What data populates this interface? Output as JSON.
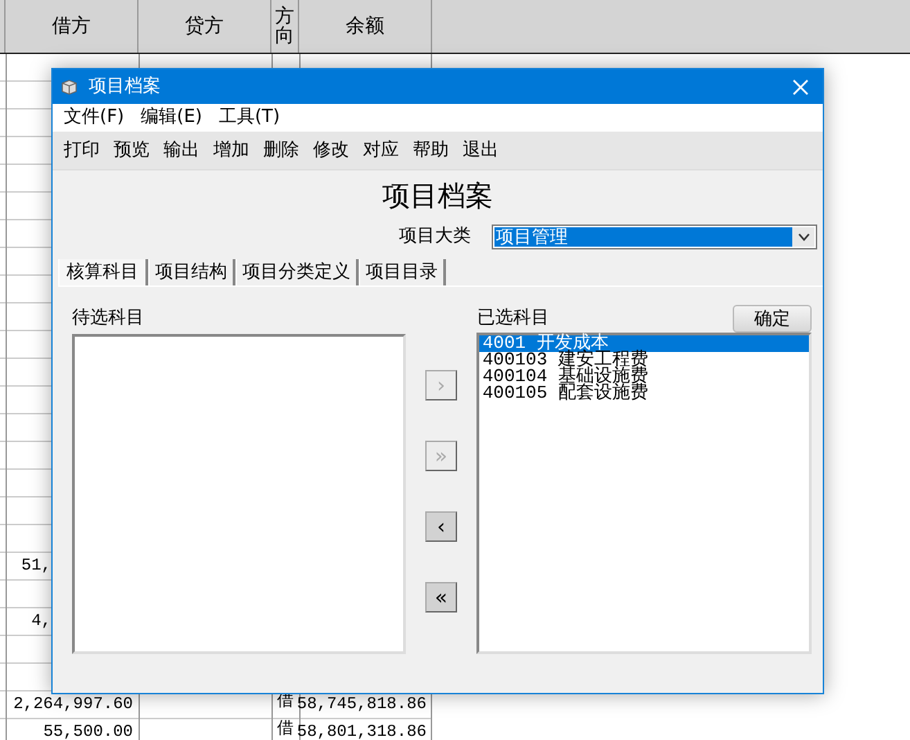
{
  "sheet": {
    "columns": [
      "借方",
      "贷方",
      "方向",
      "余额"
    ],
    "rows": [
      {},
      {},
      {},
      {},
      {},
      {},
      {},
      {},
      {},
      {},
      {},
      {},
      {},
      {},
      {},
      {},
      {},
      {},
      {
        "debit": "51,",
        "cut_by_dialog": true
      },
      {},
      {
        "debit": "4,",
        "cut_by_dialog": true
      },
      {},
      {},
      {
        "debit": "2,264,997.60",
        "direction": "借",
        "balance": "58,745,818.86"
      },
      {
        "debit": "55,500.00",
        "direction": "借",
        "balance": "58,801,318.86"
      }
    ]
  },
  "dialog": {
    "title": "项目档案",
    "menu": [
      "文件(F)",
      "编辑(E)",
      "工具(T)"
    ],
    "toolbar": [
      "打印",
      "预览",
      "输出",
      "增加",
      "删除",
      "修改",
      "对应",
      "帮助",
      "退出"
    ],
    "heading": "项目档案",
    "category": {
      "label": "项目大类",
      "value": "项目管理"
    },
    "tabs": [
      {
        "label": "核算科目",
        "selected": true
      },
      {
        "label": "项目结构",
        "selected": false
      },
      {
        "label": "项目分类定义",
        "selected": false
      },
      {
        "label": "项目目录",
        "selected": false
      }
    ],
    "available": {
      "label": "待选科目"
    },
    "transfer_buttons": [
      {
        "label": "›",
        "disabled": true
      },
      {
        "label": "»",
        "disabled": true
      },
      {
        "label": "‹",
        "disabled": false
      },
      {
        "label": "«",
        "disabled": false
      }
    ],
    "chosen": {
      "label": "已选科目",
      "confirm": "确定",
      "items": [
        {
          "code": "4001",
          "name": "开发成本",
          "selected": true
        },
        {
          "code": "400103",
          "name": "建安工程费",
          "selected": false
        },
        {
          "code": "400104",
          "name": "基础设施费",
          "selected": false
        },
        {
          "code": "400105",
          "name": "配套设施费",
          "selected": false
        }
      ]
    }
  }
}
